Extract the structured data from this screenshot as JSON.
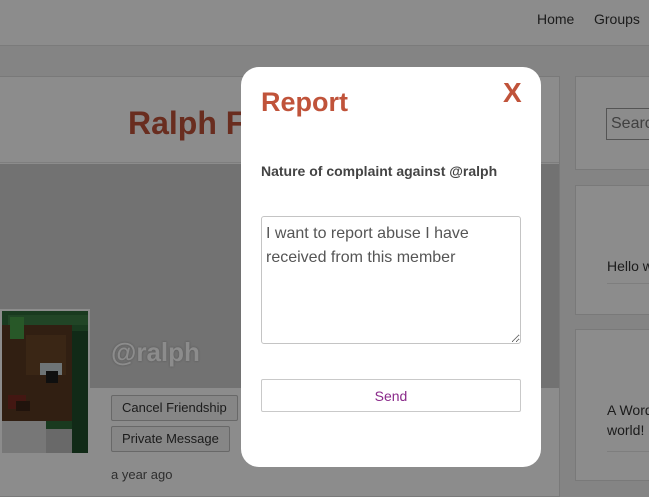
{
  "nav": {
    "items": [
      "Home",
      "Groups"
    ]
  },
  "profile": {
    "name": "Ralph Fi",
    "handle": "@ralph",
    "buttons": {
      "cancel_friendship": "Cancel Friendship",
      "private_message": "Private Message"
    },
    "last_active": "a year ago"
  },
  "sidebar": {
    "search_placeholder": "Searc",
    "hello_text": "Hello w",
    "post_text": "A Word world!"
  },
  "modal": {
    "title": "Report",
    "close_label": "X",
    "label": "Nature of complaint against @ralph",
    "complaint_text": "I want to report abuse I have received from this member",
    "send_label": "Send"
  },
  "colors": {
    "accent": "#c0533a",
    "send_text": "#8a2a8a"
  }
}
